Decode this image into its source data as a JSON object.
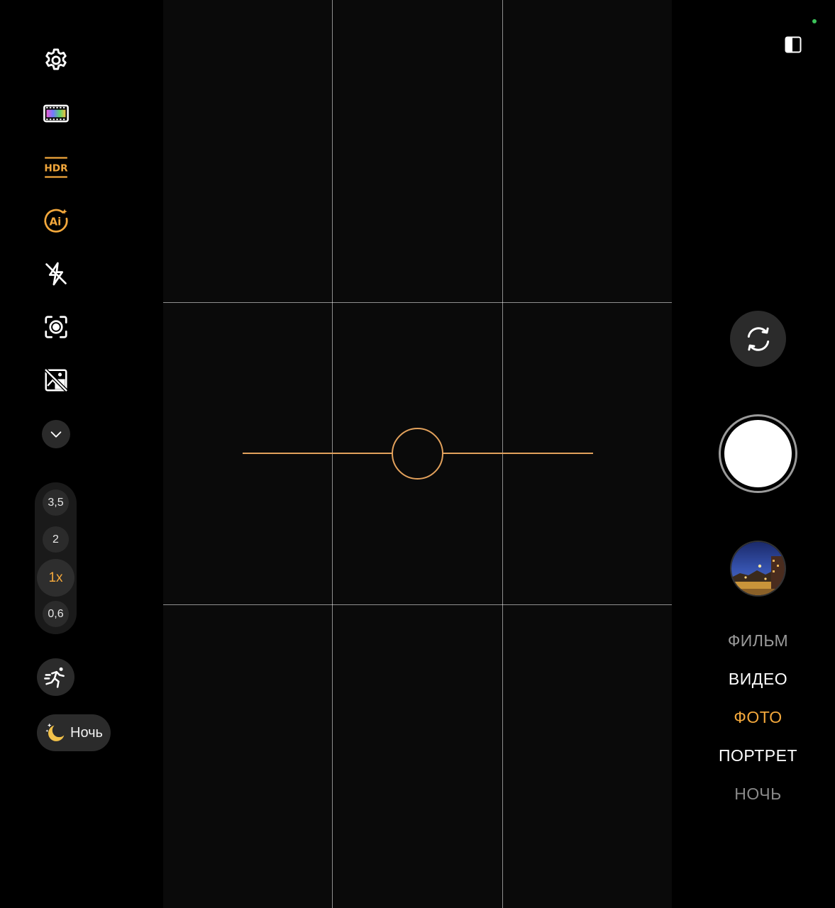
{
  "colors": {
    "accent": "#f3a83c",
    "level": "#e2a15c",
    "status_dot": "#3cc35a",
    "mode_default": "#ffffff",
    "mode_faded": "#9a9a9a"
  },
  "left_toolbar": {
    "icons": [
      "gear-icon",
      "film-filter-icon",
      "hdr-icon",
      "ai-scene-icon",
      "flash-off-icon",
      "focus-target-icon",
      "no-sticker-icon",
      "chevron-down-icon"
    ],
    "hdr_label": "HDR",
    "hdr_active": true,
    "ai_label": "Ai",
    "ai_active": true
  },
  "zoom": {
    "levels": [
      "3,5",
      "2",
      "1x",
      "0,6"
    ],
    "selected": "1x"
  },
  "motion": {
    "icon": "running-person-icon"
  },
  "night_chip": {
    "icon": "moon-stars-icon",
    "label": "Ночь"
  },
  "top_right": {
    "icon": "split-screen-icon"
  },
  "controls": {
    "flip_icon": "camera-flip-icon",
    "shutter_icon": "shutter-button",
    "gallery_icon": "gallery-thumbnail"
  },
  "modes": [
    {
      "label": "ФИЛЬМ",
      "state": "faded"
    },
    {
      "label": "ВИДЕО",
      "state": "normal"
    },
    {
      "label": "ФОТО",
      "state": "selected"
    },
    {
      "label": "ПОРТРЕТ",
      "state": "normal"
    },
    {
      "label": "НОЧЬ",
      "state": "faded"
    }
  ]
}
